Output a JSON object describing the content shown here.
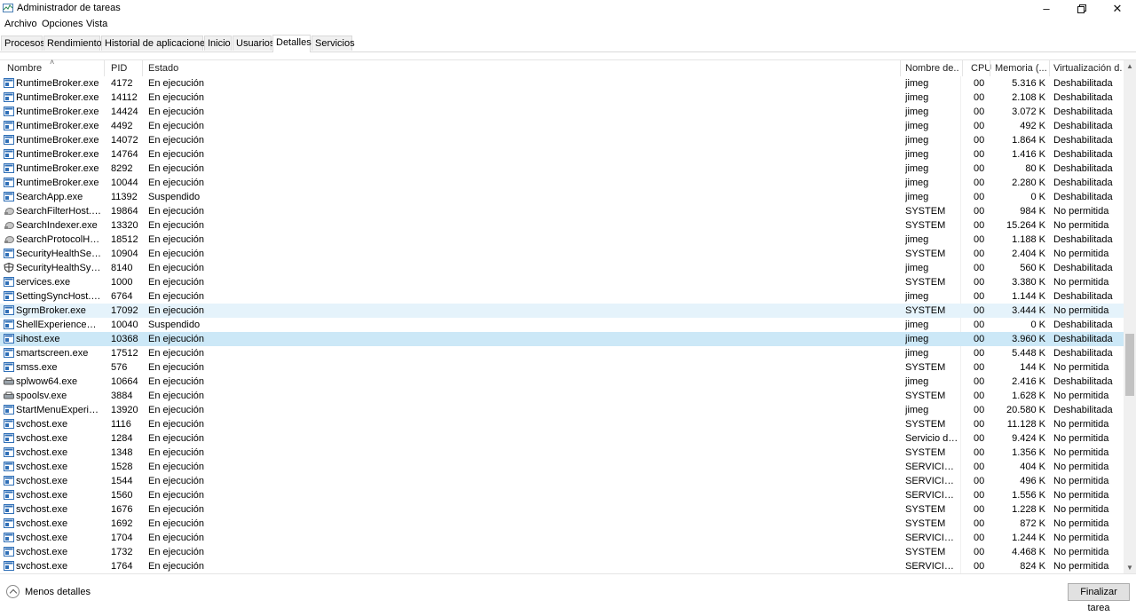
{
  "window": {
    "title": "Administrador de tareas",
    "minimize_icon": "minimize-icon",
    "maximize_icon": "restore-icon",
    "close_icon": "close-icon"
  },
  "menu": [
    "Archivo",
    "Opciones",
    "Vista"
  ],
  "tabs": [
    {
      "label": "Procesos",
      "active": false
    },
    {
      "label": "Rendimiento",
      "active": false
    },
    {
      "label": "Historial de aplicaciones",
      "active": false
    },
    {
      "label": "Inicio",
      "active": false
    },
    {
      "label": "Usuarios",
      "active": false
    },
    {
      "label": "Detalles",
      "active": true
    },
    {
      "label": "Servicios",
      "active": false
    }
  ],
  "columns": {
    "name": "Nombre",
    "pid": "PID",
    "state": "Estado",
    "user": "Nombre de...",
    "cpu": "CPU",
    "memory": "Memoria (...",
    "virt": "Virtualización d..."
  },
  "rows": [
    {
      "icon": "app",
      "name": "RuntimeBroker.exe",
      "pid": "4172",
      "state": "En ejecución",
      "user": "jimeg",
      "cpu": "00",
      "mem": "5.316 K",
      "virt": "Deshabilitada"
    },
    {
      "icon": "app",
      "name": "RuntimeBroker.exe",
      "pid": "14112",
      "state": "En ejecución",
      "user": "jimeg",
      "cpu": "00",
      "mem": "2.108 K",
      "virt": "Deshabilitada"
    },
    {
      "icon": "app",
      "name": "RuntimeBroker.exe",
      "pid": "14424",
      "state": "En ejecución",
      "user": "jimeg",
      "cpu": "00",
      "mem": "3.072 K",
      "virt": "Deshabilitada"
    },
    {
      "icon": "app",
      "name": "RuntimeBroker.exe",
      "pid": "4492",
      "state": "En ejecución",
      "user": "jimeg",
      "cpu": "00",
      "mem": "492 K",
      "virt": "Deshabilitada"
    },
    {
      "icon": "app",
      "name": "RuntimeBroker.exe",
      "pid": "14072",
      "state": "En ejecución",
      "user": "jimeg",
      "cpu": "00",
      "mem": "1.864 K",
      "virt": "Deshabilitada"
    },
    {
      "icon": "app",
      "name": "RuntimeBroker.exe",
      "pid": "14764",
      "state": "En ejecución",
      "user": "jimeg",
      "cpu": "00",
      "mem": "1.416 K",
      "virt": "Deshabilitada"
    },
    {
      "icon": "app",
      "name": "RuntimeBroker.exe",
      "pid": "8292",
      "state": "En ejecución",
      "user": "jimeg",
      "cpu": "00",
      "mem": "80 K",
      "virt": "Deshabilitada"
    },
    {
      "icon": "app",
      "name": "RuntimeBroker.exe",
      "pid": "10044",
      "state": "En ejecución",
      "user": "jimeg",
      "cpu": "00",
      "mem": "2.280 K",
      "virt": "Deshabilitada"
    },
    {
      "icon": "app",
      "name": "SearchApp.exe",
      "pid": "11392",
      "state": "Suspendido",
      "user": "jimeg",
      "cpu": "00",
      "mem": "0 K",
      "virt": "Deshabilitada"
    },
    {
      "icon": "search",
      "name": "SearchFilterHost.exe",
      "pid": "19864",
      "state": "En ejecución",
      "user": "SYSTEM",
      "cpu": "00",
      "mem": "984 K",
      "virt": "No permitida"
    },
    {
      "icon": "search",
      "name": "SearchIndexer.exe",
      "pid": "13320",
      "state": "En ejecución",
      "user": "SYSTEM",
      "cpu": "00",
      "mem": "15.264 K",
      "virt": "No permitida"
    },
    {
      "icon": "search",
      "name": "SearchProtocolHost.e...",
      "pid": "18512",
      "state": "En ejecución",
      "user": "jimeg",
      "cpu": "00",
      "mem": "1.188 K",
      "virt": "Deshabilitada"
    },
    {
      "icon": "app",
      "name": "SecurityHealthServic...",
      "pid": "10904",
      "state": "En ejecución",
      "user": "SYSTEM",
      "cpu": "00",
      "mem": "2.404 K",
      "virt": "No permitida"
    },
    {
      "icon": "shield",
      "name": "SecurityHealthSystray...",
      "pid": "8140",
      "state": "En ejecución",
      "user": "jimeg",
      "cpu": "00",
      "mem": "560 K",
      "virt": "Deshabilitada"
    },
    {
      "icon": "app",
      "name": "services.exe",
      "pid": "1000",
      "state": "En ejecución",
      "user": "SYSTEM",
      "cpu": "00",
      "mem": "3.380 K",
      "virt": "No permitida"
    },
    {
      "icon": "app",
      "name": "SettingSyncHost.exe",
      "pid": "6764",
      "state": "En ejecución",
      "user": "jimeg",
      "cpu": "00",
      "mem": "1.144 K",
      "virt": "Deshabilitada"
    },
    {
      "icon": "app",
      "name": "SgrmBroker.exe",
      "pid": "17092",
      "state": "En ejecución",
      "user": "SYSTEM",
      "cpu": "00",
      "mem": "3.444 K",
      "virt": "No permitida",
      "hl": "hover"
    },
    {
      "icon": "app",
      "name": "ShellExperienceHost...",
      "pid": "10040",
      "state": "Suspendido",
      "user": "jimeg",
      "cpu": "00",
      "mem": "0 K",
      "virt": "Deshabilitada"
    },
    {
      "icon": "app",
      "name": "sihost.exe",
      "pid": "10368",
      "state": "En ejecución",
      "user": "jimeg",
      "cpu": "00",
      "mem": "3.960 K",
      "virt": "Deshabilitada",
      "hl": "selected"
    },
    {
      "icon": "app",
      "name": "smartscreen.exe",
      "pid": "17512",
      "state": "En ejecución",
      "user": "jimeg",
      "cpu": "00",
      "mem": "5.448 K",
      "virt": "Deshabilitada"
    },
    {
      "icon": "app",
      "name": "smss.exe",
      "pid": "576",
      "state": "En ejecución",
      "user": "SYSTEM",
      "cpu": "00",
      "mem": "144 K",
      "virt": "No permitida"
    },
    {
      "icon": "printer",
      "name": "splwow64.exe",
      "pid": "10664",
      "state": "En ejecución",
      "user": "jimeg",
      "cpu": "00",
      "mem": "2.416 K",
      "virt": "Deshabilitada"
    },
    {
      "icon": "printer",
      "name": "spoolsv.exe",
      "pid": "3884",
      "state": "En ejecución",
      "user": "SYSTEM",
      "cpu": "00",
      "mem": "1.628 K",
      "virt": "No permitida"
    },
    {
      "icon": "app",
      "name": "StartMenuExperience...",
      "pid": "13920",
      "state": "En ejecución",
      "user": "jimeg",
      "cpu": "00",
      "mem": "20.580 K",
      "virt": "Deshabilitada"
    },
    {
      "icon": "app",
      "name": "svchost.exe",
      "pid": "1116",
      "state": "En ejecución",
      "user": "SYSTEM",
      "cpu": "00",
      "mem": "11.128 K",
      "virt": "No permitida"
    },
    {
      "icon": "app",
      "name": "svchost.exe",
      "pid": "1284",
      "state": "En ejecución",
      "user": "Servicio de ...",
      "cpu": "00",
      "mem": "9.424 K",
      "virt": "No permitida"
    },
    {
      "icon": "app",
      "name": "svchost.exe",
      "pid": "1348",
      "state": "En ejecución",
      "user": "SYSTEM",
      "cpu": "00",
      "mem": "1.356 K",
      "virt": "No permitida"
    },
    {
      "icon": "app",
      "name": "svchost.exe",
      "pid": "1528",
      "state": "En ejecución",
      "user": "SERVICIO L...",
      "cpu": "00",
      "mem": "404 K",
      "virt": "No permitida"
    },
    {
      "icon": "app",
      "name": "svchost.exe",
      "pid": "1544",
      "state": "En ejecución",
      "user": "SERVICIO L...",
      "cpu": "00",
      "mem": "496 K",
      "virt": "No permitida"
    },
    {
      "icon": "app",
      "name": "svchost.exe",
      "pid": "1560",
      "state": "En ejecución",
      "user": "SERVICIO L...",
      "cpu": "00",
      "mem": "1.556 K",
      "virt": "No permitida"
    },
    {
      "icon": "app",
      "name": "svchost.exe",
      "pid": "1676",
      "state": "En ejecución",
      "user": "SYSTEM",
      "cpu": "00",
      "mem": "1.228 K",
      "virt": "No permitida"
    },
    {
      "icon": "app",
      "name": "svchost.exe",
      "pid": "1692",
      "state": "En ejecución",
      "user": "SYSTEM",
      "cpu": "00",
      "mem": "872 K",
      "virt": "No permitida"
    },
    {
      "icon": "app",
      "name": "svchost.exe",
      "pid": "1704",
      "state": "En ejecución",
      "user": "SERVICIO L...",
      "cpu": "00",
      "mem": "1.244 K",
      "virt": "No permitida"
    },
    {
      "icon": "app",
      "name": "svchost.exe",
      "pid": "1732",
      "state": "En ejecución",
      "user": "SYSTEM",
      "cpu": "00",
      "mem": "4.468 K",
      "virt": "No permitida"
    },
    {
      "icon": "app",
      "name": "svchost.exe",
      "pid": "1764",
      "state": "En ejecución",
      "user": "SERVICIO L...",
      "cpu": "00",
      "mem": "824 K",
      "virt": "No permitida"
    }
  ],
  "footer": {
    "less_details": "Menos detalles",
    "end_task": "Finalizar tarea"
  },
  "colors": {
    "hover_row": "#e5f3fb",
    "selected_row": "#cce8f7",
    "app_icon_blue": "#1e6fc8"
  }
}
